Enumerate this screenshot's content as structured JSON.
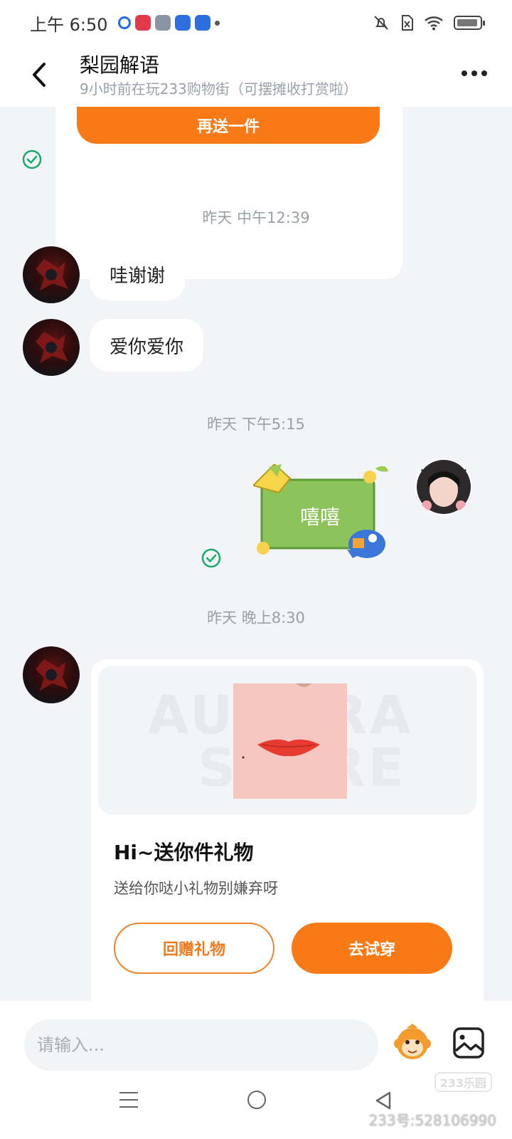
{
  "status_bar": {
    "time": "上午 6:50",
    "notification_icons": [
      "qq-icon",
      "record-icon",
      "settings-app-icon",
      "puzzle-app-icon",
      "puzzle-app-icon",
      "dot-icon"
    ],
    "system_icons": [
      "mute-icon",
      "sim-off-icon",
      "wifi-icon",
      "battery-icon"
    ]
  },
  "header": {
    "title": "梨园解语",
    "subtitle": "9小时前在玩233购物街（可摆摊收打赏啦）"
  },
  "chat": {
    "prev_card": {
      "button_label": "再送一件"
    },
    "messages": [
      {
        "type": "timestamp",
        "text": "昨天 中午12:39"
      },
      {
        "type": "text",
        "sender": "other",
        "text": "哇谢谢"
      },
      {
        "type": "text",
        "sender": "other",
        "text": "爱你爱你"
      },
      {
        "type": "timestamp",
        "text": "昨天 下午5:15"
      },
      {
        "type": "sticker",
        "sender": "self",
        "text": "嘻嘻"
      },
      {
        "type": "timestamp",
        "text": "昨天 晚上8:30"
      }
    ],
    "gift_card": {
      "image_watermark_line1": "AURORA",
      "image_watermark_line2": "STORE",
      "title": "Hi~送你件礼物",
      "description": "送给你哒小礼物别嫌弃呀",
      "return_label": "回赠礼物",
      "try_on_label": "去试穿"
    }
  },
  "input_bar": {
    "placeholder": "请输入..."
  },
  "watermark": {
    "logo": "233乐园",
    "id_text": "233号:528106990"
  },
  "colors": {
    "accent": "#f77a17",
    "read_check": "#19a96b",
    "background": "#f3f4f8",
    "sticker_green": "#8dc35b"
  }
}
